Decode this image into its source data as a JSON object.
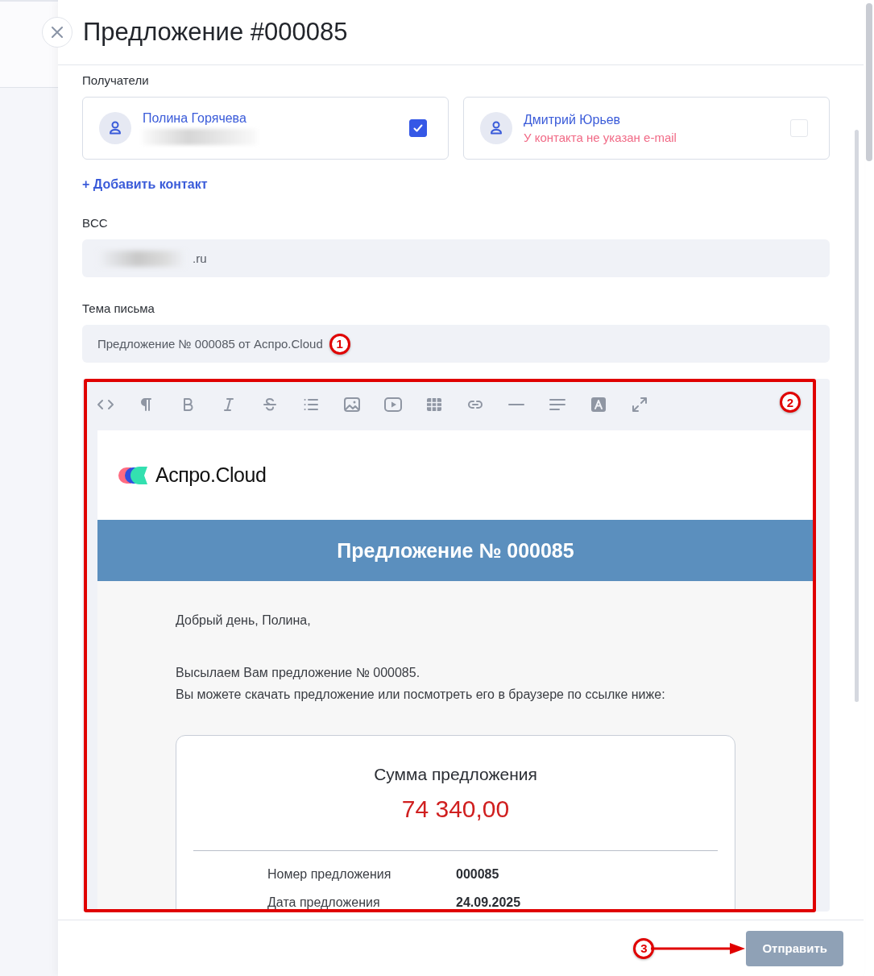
{
  "dialog": {
    "title": "Предложение #000085"
  },
  "recipients": {
    "label": "Получатели",
    "contacts": [
      {
        "name": "Полина Горячева",
        "kind": "blurred",
        "checked": true
      },
      {
        "name": "Дмитрий Юрьев",
        "kind": "warning",
        "note": "У контакта не указан e-mail",
        "checked": false
      }
    ]
  },
  "add_contact": "+ Добавить контакт",
  "bcc": {
    "label": "BCC",
    "value": ".ru",
    "blurred": true
  },
  "subject": {
    "label": "Тема письма",
    "value": "Предложение № 000085 от Аспро.Cloud"
  },
  "editor": {
    "toolbar": [
      {
        "kind": "code"
      },
      {
        "kind": "paragraph"
      },
      {
        "kind": "bold"
      },
      {
        "kind": "italic"
      },
      {
        "kind": "strike"
      },
      {
        "kind": "list"
      },
      {
        "kind": "image"
      },
      {
        "kind": "video"
      },
      {
        "kind": "table"
      },
      {
        "kind": "link"
      },
      {
        "kind": "rule"
      },
      {
        "kind": "align"
      },
      {
        "kind": "color"
      },
      {
        "kind": "fullscreen"
      }
    ],
    "email": {
      "logo": "Аспро.Cloud",
      "banner": "Предложение № 000085",
      "greeting": "Добрый день, Полина,",
      "lines": [
        "Высылаем Вам предложение № 000085.",
        "Вы можете скачать предложение или посмотреть его в браузере по ссылке ниже:"
      ],
      "summary": {
        "title": "Сумма предложения",
        "amount": "74 340,00",
        "rows": [
          {
            "label": "Номер предложения",
            "value": "000085"
          },
          {
            "label": "Дата предложения",
            "value": "24.09.2025"
          }
        ]
      }
    }
  },
  "footer": {
    "send_button": "Отправить",
    "disabled": true
  },
  "annotations": [
    {
      "label": "1",
      "kind": "inline"
    },
    {
      "label": "2",
      "kind": "frame"
    },
    {
      "label": "3",
      "kind": "arrow"
    }
  ]
}
